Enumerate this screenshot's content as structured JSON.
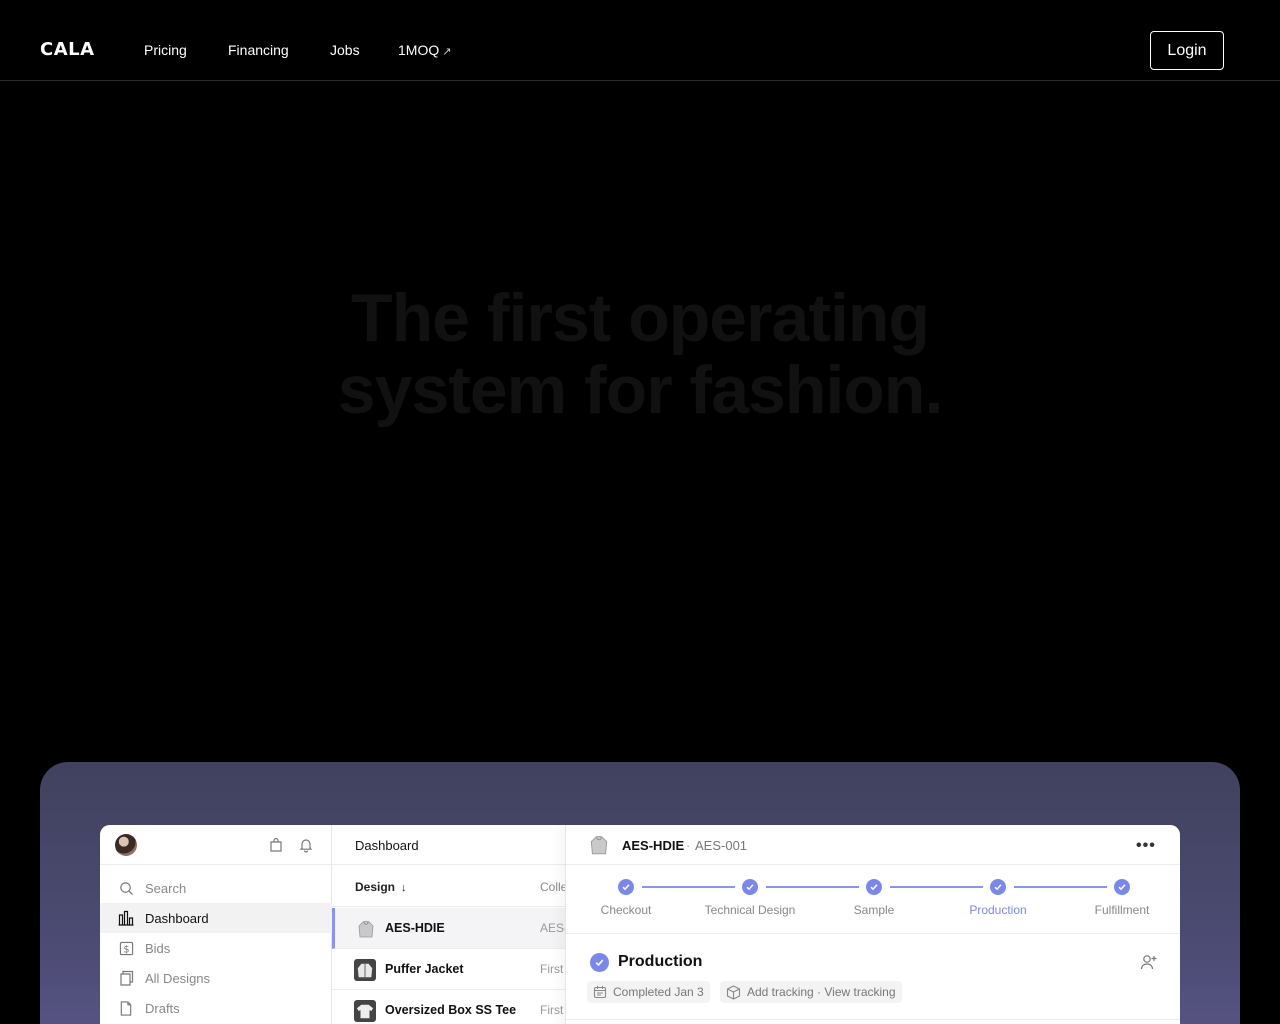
{
  "nav": {
    "logo": "CALA",
    "links": [
      "Pricing",
      "Financing",
      "Jobs",
      "1MOQ"
    ],
    "external_arrow": "↗",
    "login": "Login"
  },
  "hero": {
    "line1": "The first operating",
    "line2": "system for fashion."
  },
  "app": {
    "sidebar": {
      "items": [
        {
          "label": "Search",
          "icon": "search-icon"
        },
        {
          "label": "Dashboard",
          "icon": "bar-chart-icon",
          "active": true
        },
        {
          "label": "Bids",
          "icon": "dollar-icon"
        },
        {
          "label": "All Designs",
          "icon": "designs-icon"
        },
        {
          "label": "Drafts",
          "icon": "document-icon"
        }
      ]
    },
    "list": {
      "title": "Dashboard",
      "col_design": "Design",
      "sort_arrow": "↓",
      "col_collection": "Colle",
      "rows": [
        {
          "name": "AES-HDIE",
          "collection": "AES-",
          "selected": true
        },
        {
          "name": "Puffer Jacket",
          "collection": "First"
        },
        {
          "name": "Oversized Box SS Tee",
          "collection": "First"
        }
      ]
    },
    "detail": {
      "name": "AES-HDIE",
      "separator": "·",
      "code": "AES-001",
      "more": "•••",
      "steps": [
        "Checkout",
        "Technical Design",
        "Sample",
        "Production",
        "Fulfillment"
      ],
      "current_step": "Production",
      "stage_title": "Production",
      "chip_completed": "Completed Jan 3",
      "chip_tracking": "Add tracking · View tracking"
    }
  },
  "colors": {
    "accent": "#7c87ea",
    "panel_top": "#40425e",
    "panel_bottom": "#5a5688",
    "hero_text": "#111111"
  }
}
